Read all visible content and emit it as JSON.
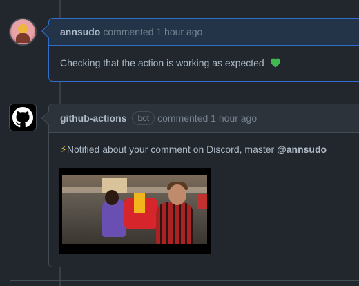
{
  "comments": [
    {
      "author": "annsudo",
      "action": "commented 1 hour ago",
      "body": "Checking that the action is working as expected",
      "emoji_icon": "green-heart-icon",
      "avatar": "user-avatar"
    },
    {
      "author": "github-actions",
      "badge": "bot",
      "action": "commented 1 hour ago",
      "body_emoji": "⚡",
      "body": "Notified about your comment on Discord, master ",
      "mention": "@annsudo",
      "avatar": "github-logo-icon",
      "media": "animated-gif"
    }
  ],
  "colors": {
    "background": "#22272e",
    "border": "#444c56",
    "highlight_border": "#316dca",
    "text": "#adbac7",
    "muted": "#768390"
  }
}
